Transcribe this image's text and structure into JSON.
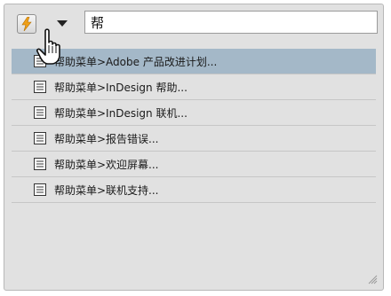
{
  "search": {
    "value": "帮"
  },
  "icons": {
    "bolt": "lightning-bolt-icon",
    "dropdown": "triangle-down-icon",
    "document": "document-icon",
    "cursor": "hand-pointer-icon",
    "grip": "resize-grip-icon"
  },
  "colors": {
    "panel_bg": "#e1e1e1",
    "selected_row": "#a4b8c8",
    "bolt": "#f0a018"
  },
  "results": {
    "items": [
      {
        "label": "帮助菜单>Adobe 产品改进计划..."
      },
      {
        "label": "帮助菜单>InDesign 帮助..."
      },
      {
        "label": "帮助菜单>InDesign 联机..."
      },
      {
        "label": "帮助菜单>报告错误..."
      },
      {
        "label": "帮助菜单>欢迎屏幕..."
      },
      {
        "label": "帮助菜单>联机支持..."
      }
    ]
  }
}
